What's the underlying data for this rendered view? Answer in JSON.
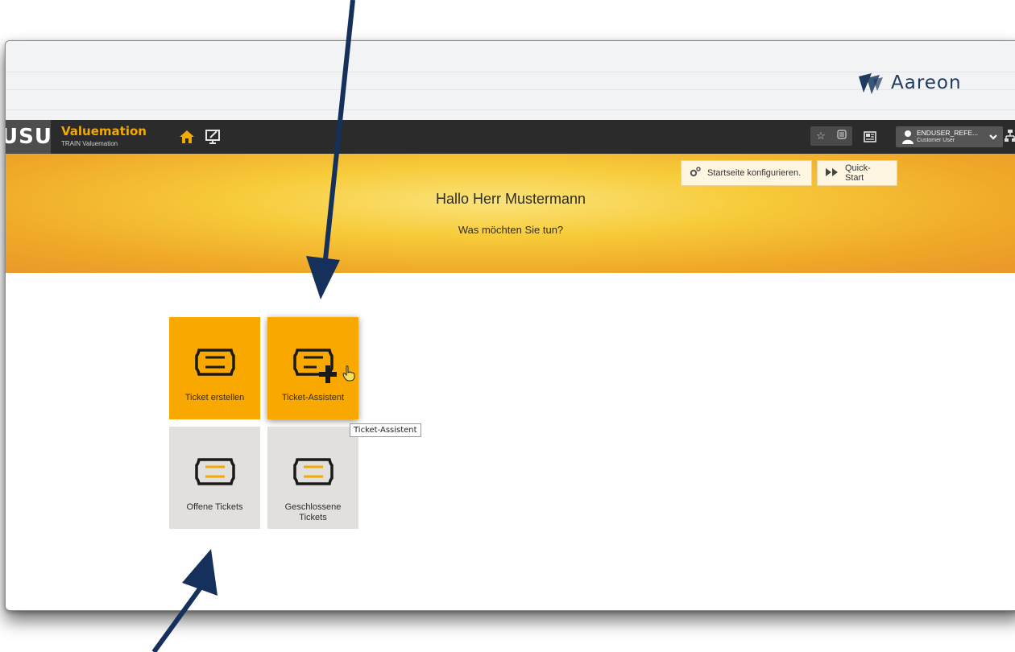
{
  "brand": {
    "logo_text": "Aareon"
  },
  "topbar": {
    "vendor_badge": "USU",
    "app_name": "Valuemation",
    "app_subtitle": "TRAIN Valuemation",
    "user": {
      "name": "ENDUSER_REFE...",
      "role": "Customer User"
    }
  },
  "banner": {
    "configure_label": "Startseite konfigurieren.",
    "quickstart_label": "Quick-Start",
    "greeting": "Hallo Herr Mustermann",
    "question": "Was möchten Sie tun?"
  },
  "tiles": [
    {
      "label": "Ticket erstellen",
      "style": "orange"
    },
    {
      "label": "Ticket-Assistent",
      "style": "orange"
    },
    {
      "label": "Offene Tickets",
      "style": "gray"
    },
    {
      "label": "Geschlossene Tickets",
      "style": "gray"
    }
  ],
  "tooltip": "Ticket-Assistent",
  "colors": {
    "accent": "#f9a800",
    "topbar": "#2b2b2b",
    "arrow": "#16305c",
    "tile_gray": "#e1e0dc"
  }
}
